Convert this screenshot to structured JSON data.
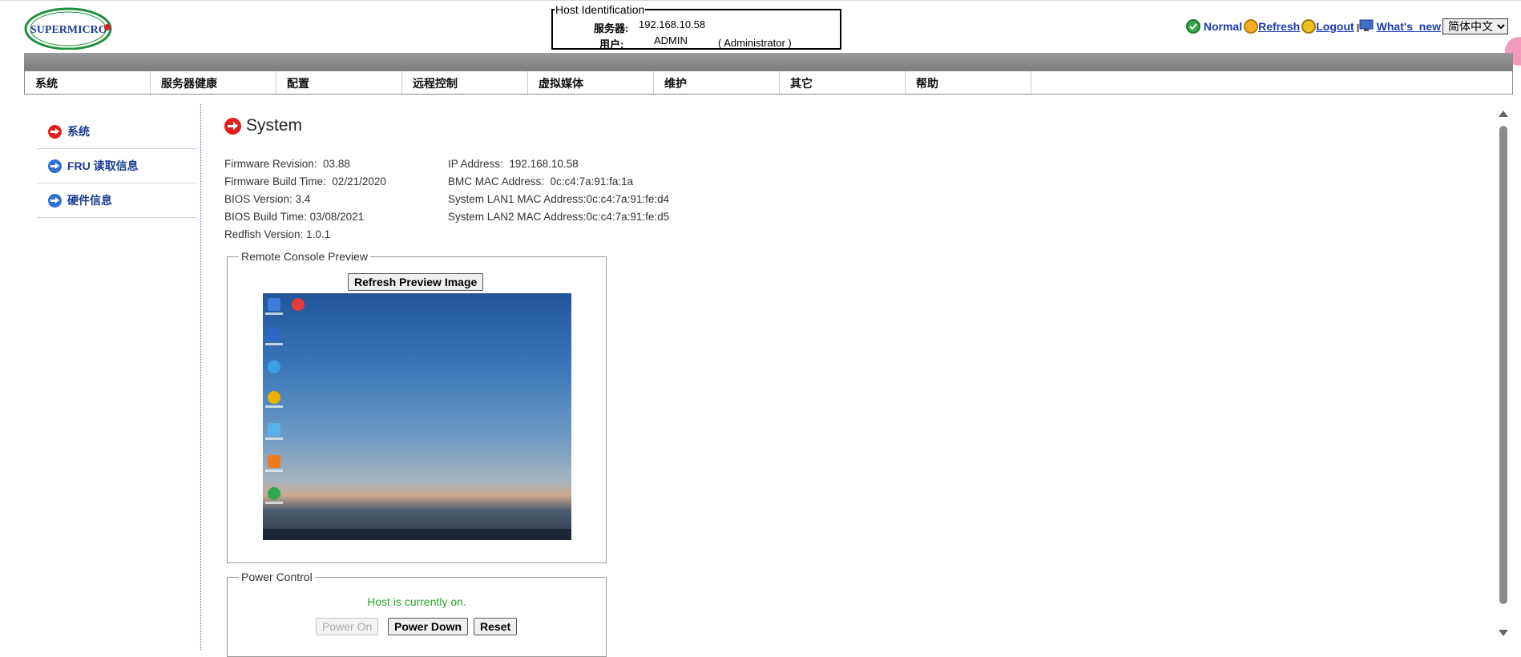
{
  "host_identification": {
    "legend": "Host Identification",
    "server_label": "服务器:",
    "server_value": "192.168.10.58",
    "user_label": "用户:",
    "user_value": "ADMIN",
    "user_role": "( Administrator )"
  },
  "logo_text": "SUPERMICRO",
  "top_links": {
    "status": "Normal",
    "refresh": "Refresh",
    "logout": "Logout",
    "whats_new": "What's_new",
    "language": "简体中文"
  },
  "menu": [
    "系统",
    "服务器健康",
    "配置",
    "远程控制",
    "虚拟媒体",
    "维护",
    "其它",
    "帮助"
  ],
  "sidebar": [
    {
      "label": "系统",
      "icon": "arrow-right-red-icon",
      "color": "#e02020"
    },
    {
      "label": "FRU 读取信息",
      "icon": "arrow-right-blue-icon",
      "color": "#2f6fd6"
    },
    {
      "label": "硬件信息",
      "icon": "arrow-right-blue-icon",
      "color": "#2f6fd6"
    }
  ],
  "page_title": "System",
  "info_left": [
    {
      "label": "Firmware Revision:",
      "value": "03.88"
    },
    {
      "label": "Firmware Build Time:",
      "value": "02/21/2020"
    },
    {
      "label": "BIOS Version:",
      "value": "3.4"
    },
    {
      "label": "BIOS Build Time:",
      "value": "03/08/2021"
    },
    {
      "label": "Redfish Version:",
      "value": "1.0.1"
    }
  ],
  "info_right": [
    {
      "label": "IP Address:",
      "value": "192.168.10.58"
    },
    {
      "label": "BMC MAC Address:",
      "value": "0c:c4:7a:91:fa:1a"
    },
    {
      "label": "System LAN1 MAC Address:",
      "value": "0c:c4:7a:91:fe:d4"
    },
    {
      "label": "System LAN2 MAC Address:",
      "value": "0c:c4:7a:91:fe:d5"
    }
  ],
  "remote_console": {
    "legend": "Remote Console Preview",
    "refresh_button": "Refresh Preview Image"
  },
  "power_control": {
    "legend": "Power Control",
    "status": "Host is currently on.",
    "status_color": "#2aa52a",
    "power_on": "Power On",
    "power_down": "Power Down",
    "reset": "Reset"
  },
  "colors": {
    "link": "#1a3bb5",
    "menu_bar": "#8c8c8c"
  }
}
